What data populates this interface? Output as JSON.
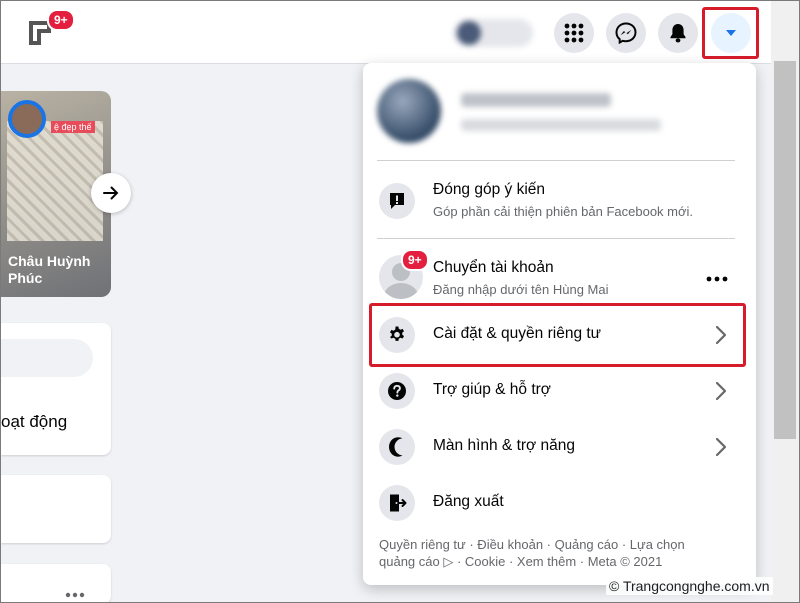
{
  "topbar": {
    "notification_badge": "9+",
    "icons": [
      "logo-icon",
      "menu-grid-icon",
      "messenger-icon",
      "bell-icon",
      "caret-down-icon"
    ]
  },
  "left": {
    "story_name": "Châu Huỳnh Phúc",
    "story_tag": "ệ đẹp thế",
    "activity_fragment": "oạt động"
  },
  "menu": {
    "feedback": {
      "title": "Đóng góp ý kiến",
      "subtitle": "Góp phần cải thiện phiên bản Facebook mới."
    },
    "switch_account": {
      "badge": "9+",
      "title": "Chuyển tài khoản",
      "subtitle": "Đăng nhập dưới tên Hùng Mai"
    },
    "items": [
      {
        "label": "Cài đặt & quyền riêng tư"
      },
      {
        "label": "Trợ giúp & hỗ trợ"
      },
      {
        "label": "Màn hình & trợ năng"
      },
      {
        "label": "Đăng xuất"
      }
    ],
    "footer_line1": "Quyền riêng tư · Điều khoản · Quảng cáo · Lựa chọn",
    "footer_line2": "quảng cáo ▷ · Cookie · Xem thêm · Meta © 2021"
  },
  "watermark": "© Trangcongnghe.com.vn",
  "colors": {
    "highlight": "#d61c2a",
    "accent": "#1b74e4",
    "badge": "#e41e3f"
  }
}
